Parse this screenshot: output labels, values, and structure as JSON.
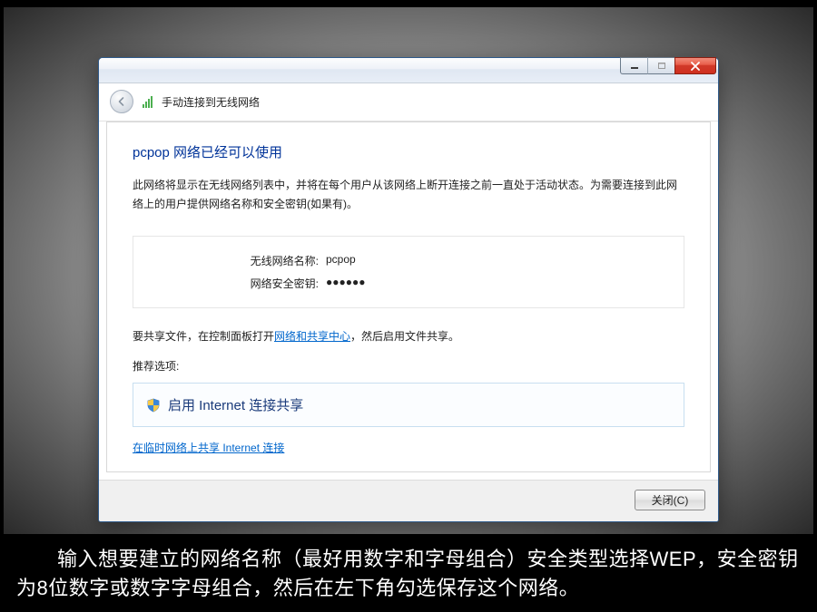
{
  "header": {
    "title": "手动连接到无线网络"
  },
  "content": {
    "success_title": "pcpop 网络已经可以使用",
    "description": "此网络将显示在无线网络列表中，并将在每个用户从该网络上断开连接之前一直处于活动状态。为需要连接到此网络上的用户提供网络名称和安全密钥(如果有)。",
    "info": {
      "name_label": "无线网络名称:",
      "name_value": "pcpop",
      "key_label": "网络安全密钥:",
      "key_value": "●●●●●●"
    },
    "share_prefix": "要共享文件，在控制面板打开",
    "share_link": "网络和共享中心",
    "share_suffix": "，然后启用文件共享。",
    "recommend": "推荐选项:",
    "option_text": "启用 Internet 连接共享",
    "sub_link": "在临时网络上共享 Internet 连接"
  },
  "footer": {
    "close_label": "关闭(C)"
  },
  "caption": "　　输入想要建立的网络名称（最好用数字和字母组合）安全类型选择WEP，安全密钥为8位数字或数字字母组合，然后在左下角勾选保存这个网络。"
}
